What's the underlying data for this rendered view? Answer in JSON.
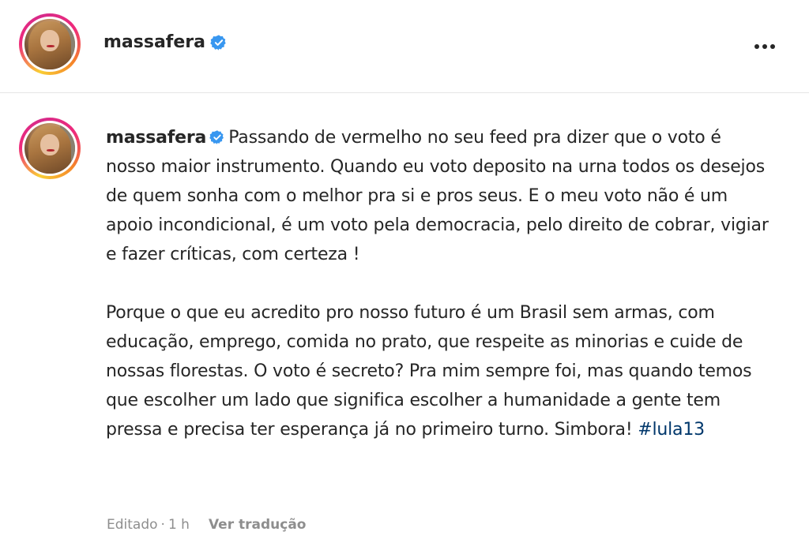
{
  "header": {
    "username": "massafera",
    "verified": true,
    "more_icon": "more-horizontal-icon"
  },
  "post": {
    "author": "massafera",
    "paragraph1": "Passando de vermelho no seu feed pra dizer que o voto é nosso maior instrumento. Quando eu voto deposito na urna todos os desejos de quem sonha com o melhor pra si e pros seus. E o meu voto não é um apoio incondicional, é um voto pela democracia, pelo direito de cobrar, vigiar e fazer críticas, com certeza !",
    "paragraph2": "Porque o que eu acredito pro nosso futuro é um Brasil sem armas, com educação, emprego, comida no prato, que respeite as minorias e cuide de nossas florestas. O voto é secreto? Pra mim sempre foi, mas quando temos que escolher um lado que significa escolher a humanidade a gente tem pressa e precisa ter esperança já no primeiro turno. Simbora!",
    "hashtag": "#lula13"
  },
  "meta": {
    "edited": "Editado",
    "separator": "·",
    "time": "1 h",
    "translate": "Ver tradução"
  },
  "colors": {
    "verified_blue": "#3897f0",
    "hashtag": "#00376b",
    "muted": "#8e8e8e"
  }
}
